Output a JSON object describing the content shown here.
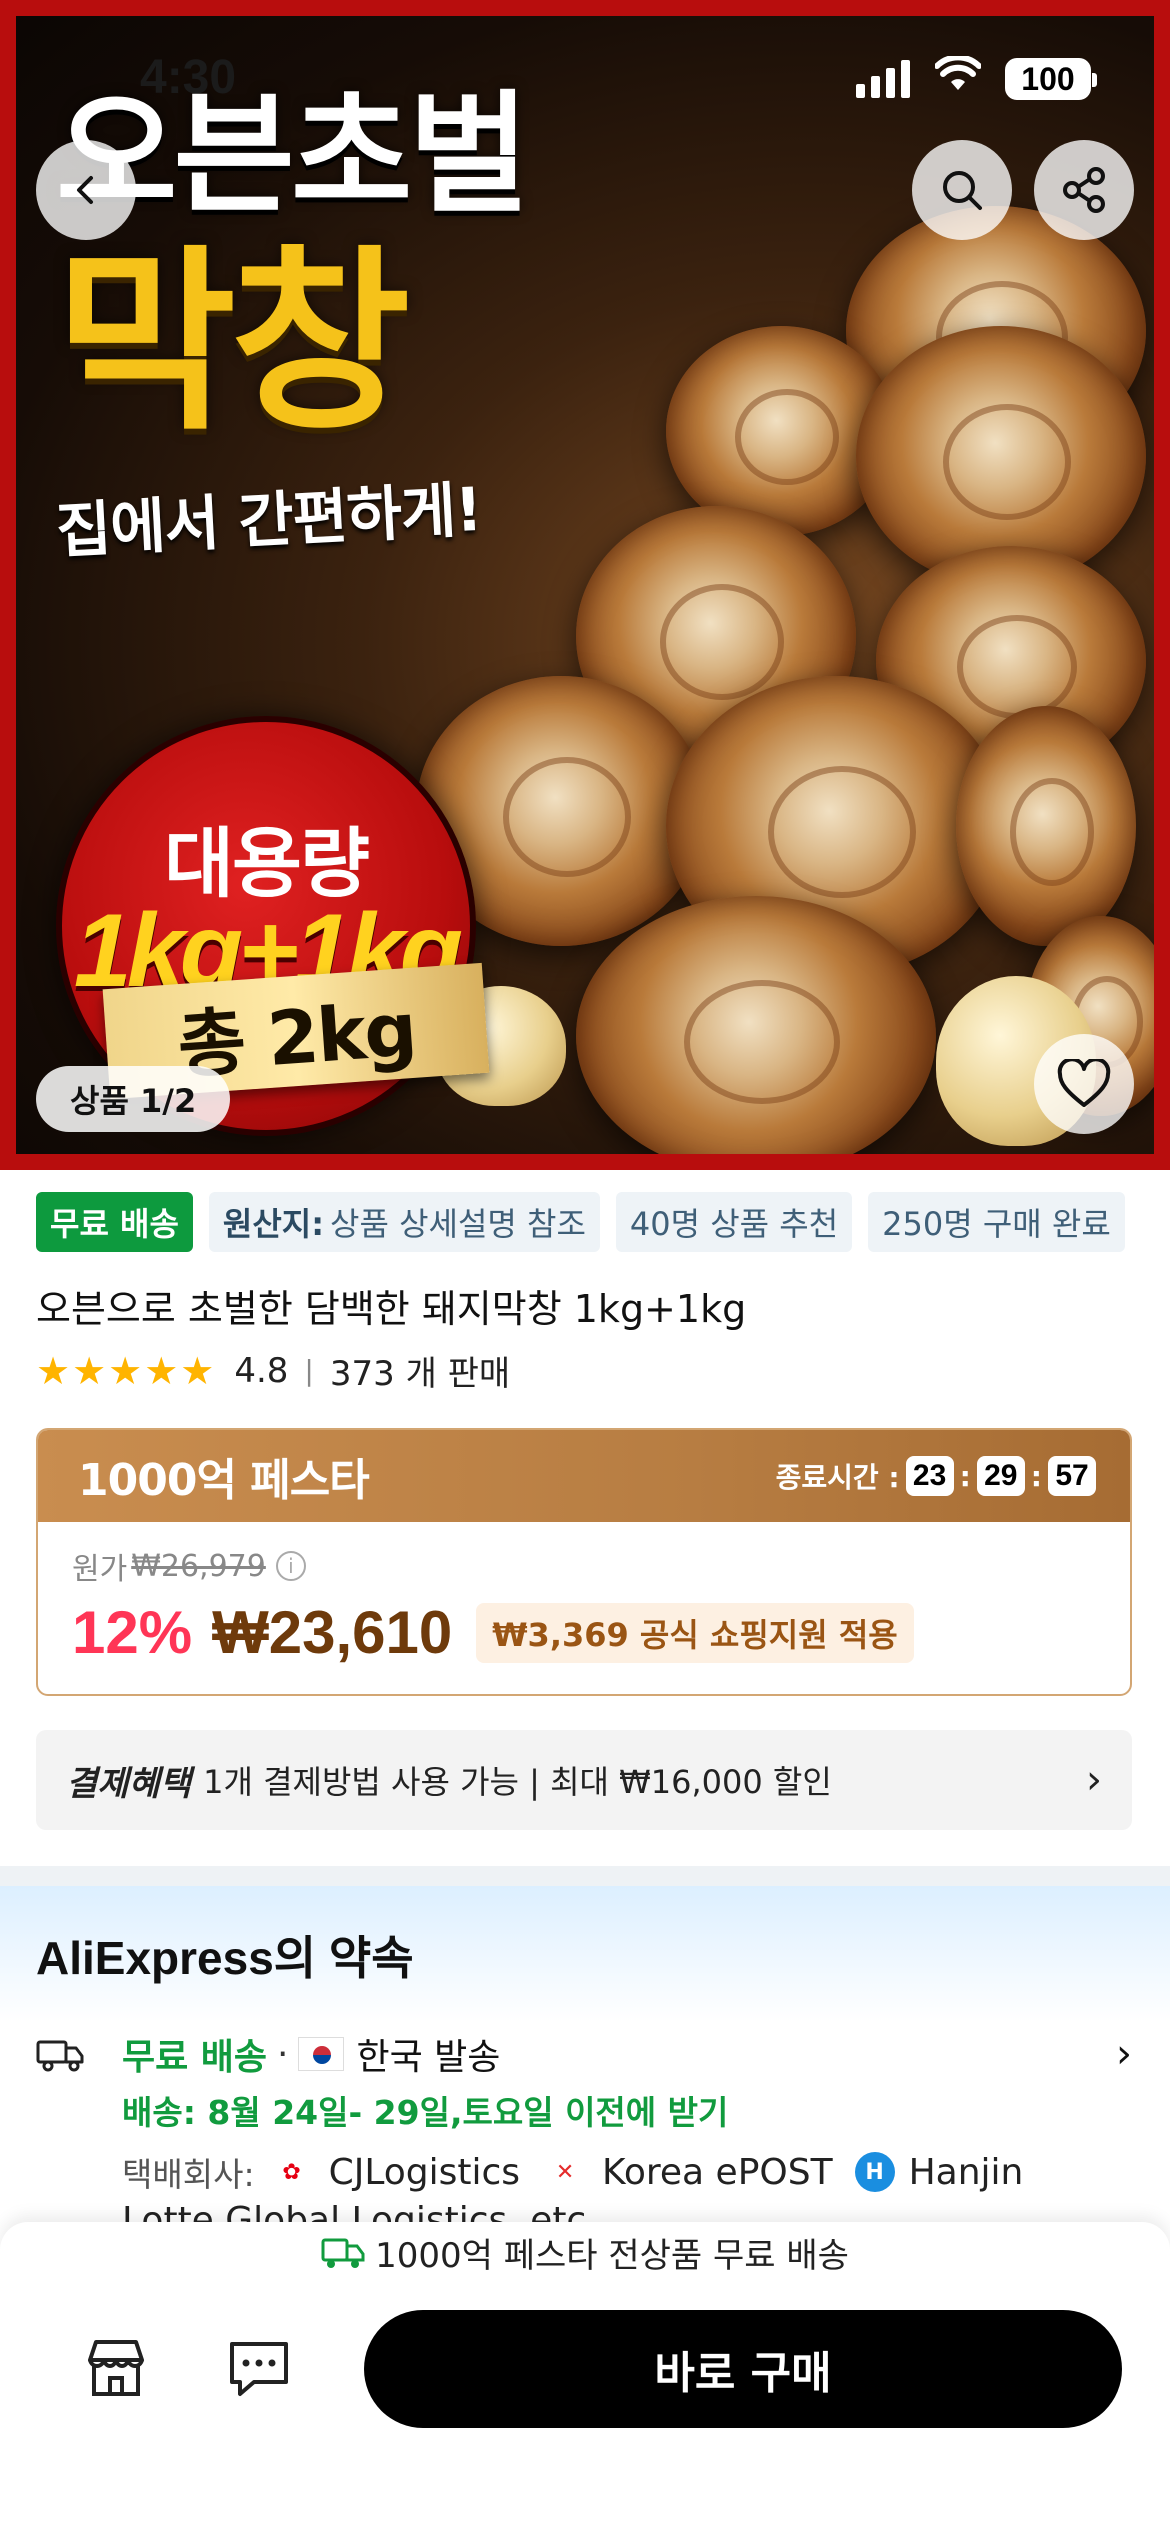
{
  "status_bar": {
    "time": "4:30",
    "battery": "100"
  },
  "hero": {
    "headline_1": "오븐초벌",
    "headline_2": "막창",
    "tagline": "집에서 간편하게!",
    "badge_line1": "대용량",
    "badge_line2": "1kg+1kg",
    "ribbon": "총 2kg",
    "page_indicator": "상품 1/2",
    "icons": [
      "back-icon",
      "search-icon",
      "share-icon",
      "heart-icon"
    ]
  },
  "tags": {
    "free_shipping": "무료 배송",
    "origin_label": "원산지:",
    "origin_value": "상품 상세설명 참조",
    "recommend": "40명 상품 추천",
    "purchased": "250명 구매 완료"
  },
  "product": {
    "title": "오븐으로 초벌한 담백한 돼지막창 1kg+1kg",
    "rating": "4.8",
    "sold": "373 개 판매",
    "rating_stars": 5
  },
  "festa": {
    "title": "1000억 페스타",
    "timer_label": "종료시간 :",
    "hours": "23",
    "minutes": "29",
    "seconds": "57",
    "original_label": "원가",
    "original_price": "₩26,979",
    "discount": "12%",
    "price": "₩23,610",
    "support": "₩3,369 공식 쇼핑지원 적용"
  },
  "payment": {
    "label": "결제혜택",
    "text": "1개 결제방법 사용 가능 | 최대 ₩16,000 할인"
  },
  "promise": {
    "title": "AliExpress의 약속",
    "free_shipping": "무료 배송",
    "origin": "한국 발송",
    "delivery": "배송: 8월 24일- 29일,토요일 이전에 받기",
    "courier_label": "택배회사:",
    "couriers": [
      "CJLogistics",
      "Korea ePOST",
      "Hanjin"
    ],
    "more": "Lotte Global Logistics, etc."
  },
  "bottom": {
    "banner": "1000억 페스타 전상품 무료 배송",
    "buy_label": "바로 구매"
  },
  "colors": {
    "green": "#0d9a3e",
    "discount_red": "#ff3556",
    "price_brown": "#6e3a0b",
    "festa_gold": "#b77d42"
  }
}
